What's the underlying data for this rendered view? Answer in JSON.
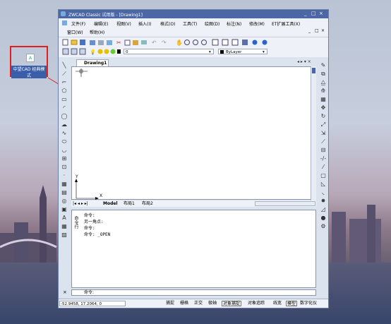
{
  "desktop": {
    "icon_label": "中望CAD 经典模式"
  },
  "window": {
    "title": "ZWCAD Classic 试用版 - [Drawing1]",
    "controls": [
      "_",
      "□",
      "×"
    ],
    "doc_controls": [
      "_",
      "□",
      "×"
    ]
  },
  "menu": {
    "row1": [
      "文件(F)",
      "编辑(E)",
      "视图(V)",
      "插入(I)",
      "格式(O)",
      "工具(T)",
      "绘图(D)",
      "标注(N)",
      "修改(M)",
      "ET扩展工具(X)"
    ],
    "row2": [
      "窗口(W)",
      "帮助(H)"
    ]
  },
  "toolbar": {
    "layer_value": "0",
    "linetype_value": "ByLayer"
  },
  "document": {
    "tab_label": "Drawing1",
    "nav_arrows": "◂ ▸ ▾ ×"
  },
  "ucs": {
    "x_label": "X",
    "y_label": "Y"
  },
  "layout_tabs": {
    "nav": "|◂ ◂ ▸ ▸|",
    "tabs": [
      "Model",
      "布局1",
      "布局2"
    ]
  },
  "command": {
    "history": [
      "命令:",
      "另一角点:",
      "命令:",
      "命令: _OPEN"
    ],
    "side_label": "命令行",
    "prompt": "命令:"
  },
  "status": {
    "coords": "-52.9458, 17.2064, 0",
    "buttons": [
      "捕捉",
      "栅格",
      "正交",
      "极轴",
      "对象捕捉",
      "对象追踪",
      "线宽",
      "模型",
      "数字化仪"
    ],
    "active": [
      "对象捕捉",
      "模型"
    ]
  },
  "colors": {
    "annotation_red": "#e02020",
    "titlebar": "#4b67a6"
  }
}
